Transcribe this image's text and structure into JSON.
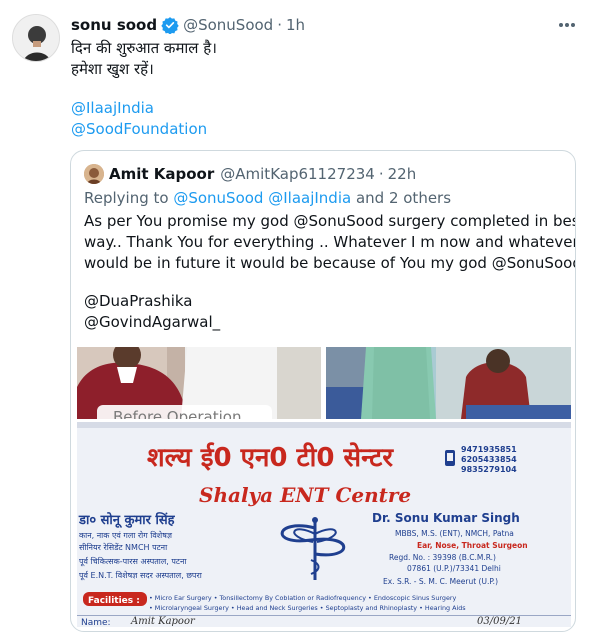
{
  "tweet": {
    "author_name": "sonu sood",
    "handle": "@SonuSood",
    "separator": "·",
    "time": "1h",
    "text_lines": [
      "दिन की शुरुआत कमाल है।",
      "हमेशा खुश रहें।"
    ],
    "mentions": [
      "@IlaajIndia",
      "@SoodFoundation"
    ]
  },
  "quote": {
    "author_name": "Amit Kapoor",
    "handle": "@AmitKap61127234",
    "separator": "·",
    "time": "22h",
    "reply_prefix": "Replying to ",
    "reply_to": "@SonuSood @IlaajIndia",
    "reply_suffix": " and 2 others",
    "body_lines": [
      "As per You promise my god @SonuSood surgery completed in best",
      "way.. Thank You for everything .. Whatever I m now and whatever I",
      "would be in future it would be because of You my god @SonuSood .."
    ],
    "mentions": [
      "@DuaPrashika",
      "@GovindAgarwal_"
    ],
    "media": {
      "overlay_text": "Before Operation",
      "card": {
        "hindi_title": "शल्य ई0 एन0 टी0 सेन्टर",
        "english_title": "Shalya ENT Centre",
        "doctor_hindi": "डा० सोनू कुमार सिंह",
        "doctor_hindi_desc1": "कान, नाक एवं गला रोग विशेषज्ञ",
        "doctor_hindi_desc2": "सीनियर रेसिडेंट NMCH पटना",
        "doctor_hindi_desc3": "पूर्व चिकित्सक-पारस अस्पताल, पटना",
        "doctor_hindi_desc4": "पूर्व E.N.T. विशेषज्ञ सदर अस्पताल, छपरा",
        "doctor_name": "Dr. Sonu Kumar Singh",
        "qualifications": "MBBS, M.S. (ENT), NMCH, Patna",
        "specialty": "Ear, Nose, Throat Surgeon",
        "regd": "Regd. No. : 39398 (B.C.M.R.)",
        "regd2": "07861 (U.P.)/73341 Delhi",
        "ex": "Ex. S.R. - S. M. C. Meerut (U.P.)",
        "phones": [
          "9471935851",
          "6205433854",
          "9835279104"
        ],
        "facilities_label": "Facilities :",
        "facilities_line1": "• Micro Ear Surgery • Tonsillectomy By Coblation or Radiofrequency • Endoscopic Sinus Surgery",
        "facilities_line2": "• Microlaryngeal Surgery • Head and Neck Surgeries • Septoplasty and Rhinoplasty • Hearing Aids",
        "name_label": "Name:",
        "name_value": "Amit Kapoor",
        "date_value": "03/09/21"
      }
    }
  },
  "colors": {
    "link": "#1d9bf0",
    "verified": "#1d9bf0",
    "secondary_text": "#536471",
    "card_red": "#c8281e",
    "card_blue": "#1f3f8f"
  },
  "icons": {
    "verified": "verified-badge-icon",
    "more": "more-horizontal-icon",
    "caduceus": "caduceus-icon",
    "phone": "phone-icon"
  }
}
